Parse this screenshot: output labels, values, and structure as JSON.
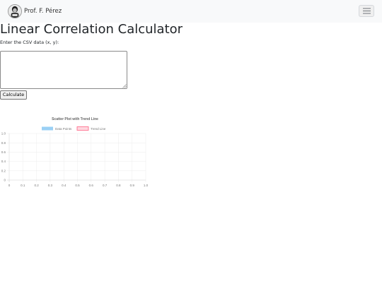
{
  "navbar": {
    "brand_name": "Prof. F. Pérez",
    "toggler_icon": "hamburger-menu-icon"
  },
  "main": {
    "title": "Linear Correlation Calculator",
    "csv_label": "Enter the CSV data (x, y):",
    "csv_value": "",
    "calculate_label": "Calculate"
  },
  "chart_data": {
    "type": "scatter",
    "title": "Scatter Plot with Trend Line",
    "series": [
      {
        "name": "Data Points",
        "x": [],
        "y": [],
        "color": "#9ad0f5"
      },
      {
        "name": "Trend Line",
        "x": [],
        "y": [],
        "color": "#ff6384"
      }
    ],
    "x_ticks": [
      "0",
      "0.1",
      "0.2",
      "0.3",
      "0.4",
      "0.5",
      "0.6",
      "0.7",
      "0.8",
      "0.9",
      "1.0"
    ],
    "y_ticks": [
      "0",
      "0.2",
      "0.4",
      "0.6",
      "0.8",
      "1.0"
    ],
    "xlim": [
      0,
      1
    ],
    "ylim": [
      0,
      1
    ],
    "grid": true,
    "legend_position": "top"
  }
}
